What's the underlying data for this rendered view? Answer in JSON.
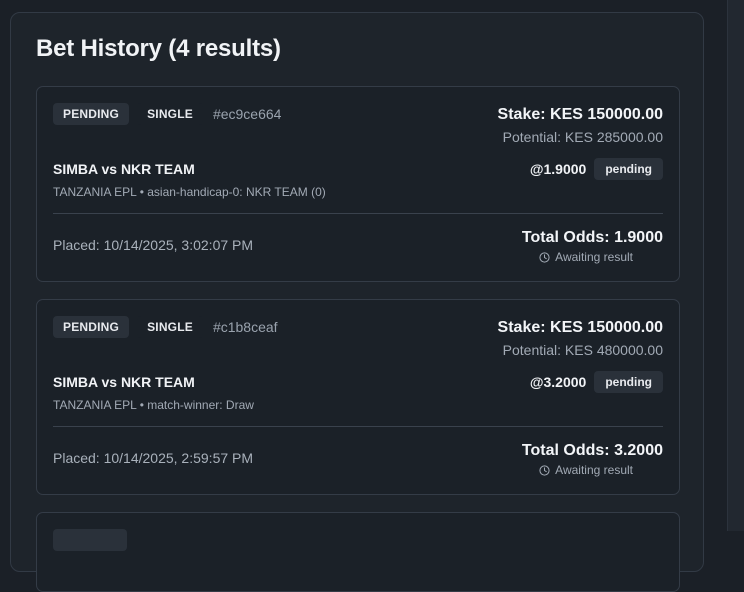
{
  "page": {
    "title": "Bet History (4 results)"
  },
  "bets": [
    {
      "status_badge": "PENDING",
      "type_badge": "SINGLE",
      "id": "#ec9ce664",
      "stake": "Stake: KES 150000.00",
      "potential": "Potential: KES 285000.00",
      "match": "SIMBA vs NKR TEAM",
      "selection": "TANZANIA EPL • asian-handicap-0: NKR TEAM (0)",
      "odds": "@1.9000",
      "leg_status": "pending",
      "placed": "Placed: 10/14/2025, 3:02:07 PM",
      "total_odds": "Total Odds: 1.9000",
      "result_status": "Awaiting result"
    },
    {
      "status_badge": "PENDING",
      "type_badge": "SINGLE",
      "id": "#c1b8ceaf",
      "stake": "Stake: KES 150000.00",
      "potential": "Potential: KES 480000.00",
      "match": "SIMBA vs NKR TEAM",
      "selection": "TANZANIA EPL • match-winner: Draw",
      "odds": "@3.2000",
      "leg_status": "pending",
      "placed": "Placed: 10/14/2025, 2:59:57 PM",
      "total_odds": "Total Odds: 3.2000",
      "result_status": "Awaiting result"
    }
  ],
  "icons": {
    "result_status": "clock-icon"
  },
  "colors": {
    "background": "#1b2027",
    "card": "#1b2128",
    "badge": "#2a313a"
  }
}
